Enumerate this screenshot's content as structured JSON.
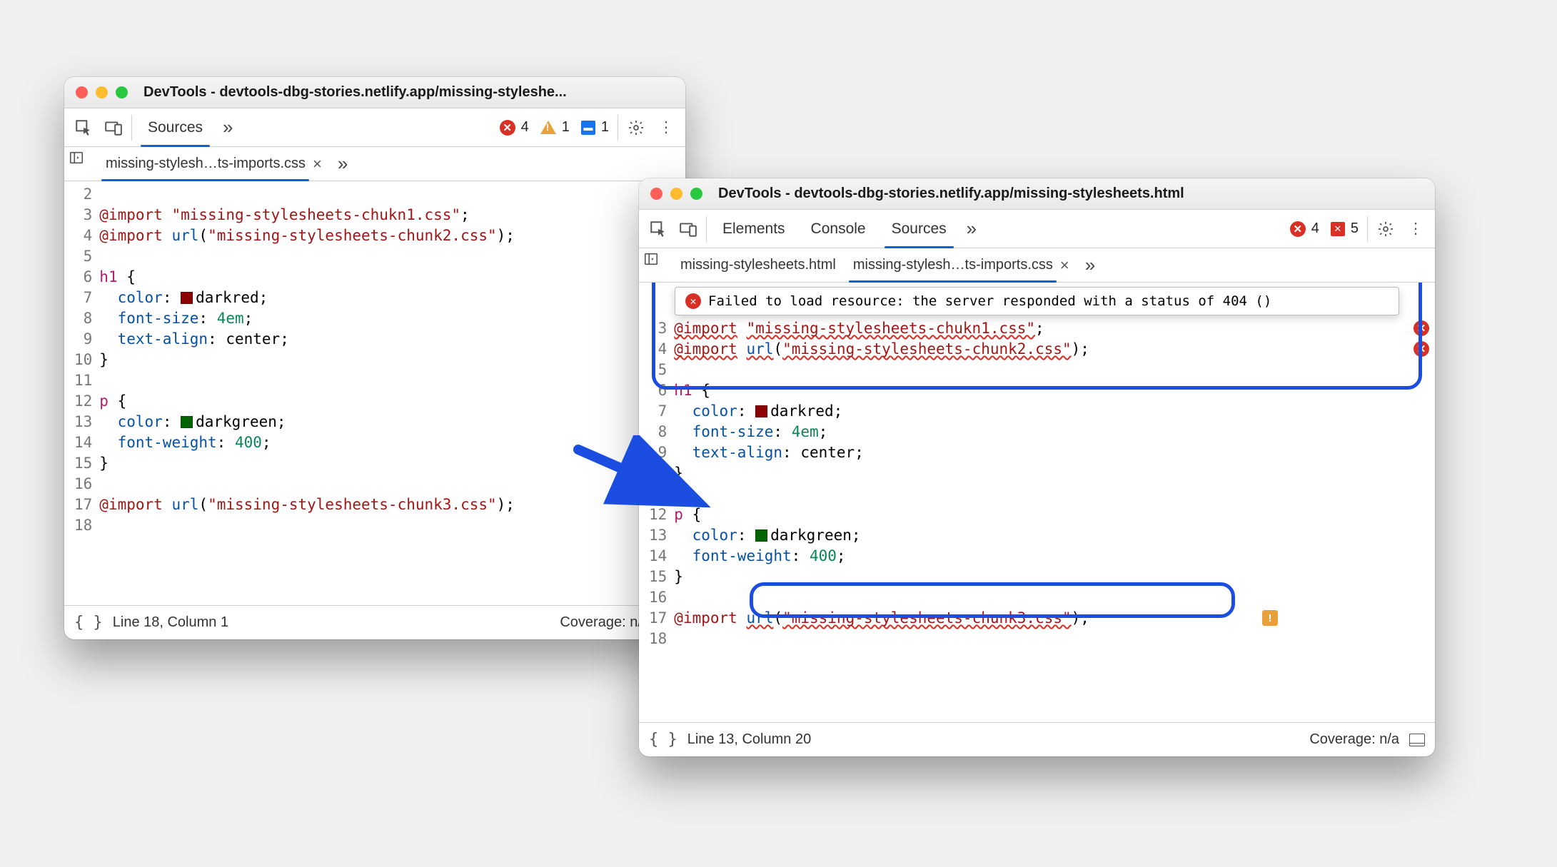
{
  "app_prefix": "DevTools - ",
  "win1": {
    "title": "devtools-dbg-stories.netlify.app/missing-styleshe...",
    "active_panel": "Sources",
    "counters": {
      "errors": "4",
      "warnings": "1",
      "issues": "1"
    },
    "open_file": "missing-stylesh…ts-imports.css",
    "lines": {
      "l2": "",
      "l3_a": "@import",
      "l3_s": "\"missing-stylesheets-chukn1.css\"",
      "l4_a": "@import",
      "l4_f": "url",
      "l4_s": "\"missing-stylesheets-chunk2.css\"",
      "l5": "",
      "l6": "h1",
      "l6b": " {",
      "l7p": "color",
      "l7v": "darkred",
      "l8p": "font-size",
      "l8v": "4em",
      "l9p": "text-align",
      "l9v": "center",
      "l10": "}",
      "l11": "",
      "l12": "p",
      "l12b": " {",
      "l13p": "color",
      "l13v": "darkgreen",
      "l14p": "font-weight",
      "l14v": "400",
      "l15": "}",
      "l16": "",
      "l17_a": "@import",
      "l17_f": "url",
      "l17_s": "\"missing-stylesheets-chunk3.css\"",
      "l18": ""
    },
    "status_pos": "Line 18, Column 1",
    "coverage": "Coverage: n/a"
  },
  "win2": {
    "title": "devtools-dbg-stories.netlify.app/missing-stylesheets.html",
    "panels": [
      "Elements",
      "Console",
      "Sources"
    ],
    "active_panel_index": 2,
    "counters": {
      "errors": "4",
      "network_errors": "5"
    },
    "tabs": [
      "missing-stylesheets.html",
      "missing-stylesh…ts-imports.css"
    ],
    "active_tab_index": 1,
    "tooltip": "Failed to load resource: the server responded with a status of 404 ()",
    "lines": {
      "l3_a": "@import",
      "l3_s": "\"missing-stylesheets-chukn1.css\"",
      "l4_a": "@import",
      "l4_f": "url",
      "l4_s": "\"missing-stylesheets-chunk2.css\"",
      "l5": "",
      "l6": "h1",
      "l6b": " {",
      "l7p": "color",
      "l7v": "darkred",
      "l8p": "font-size",
      "l8v": "4em",
      "l9p": "text-align",
      "l9v": "center",
      "l10": "}",
      "l11": "",
      "l12": "p",
      "l12b": " {",
      "l13p": "color",
      "l13v": "darkgreen",
      "l14p": "font-weight",
      "l14v": "400",
      "l15": "}",
      "l16": "",
      "l17_a": "@import",
      "l17_f": "url",
      "l17_s": "\"missing-stylesheets-chunk3.css\"",
      "l18": ""
    },
    "status_pos": "Line 13, Column 20",
    "coverage": "Coverage: n/a"
  },
  "colors": {
    "darkred": "#8b0000",
    "darkgreen": "#006400"
  }
}
